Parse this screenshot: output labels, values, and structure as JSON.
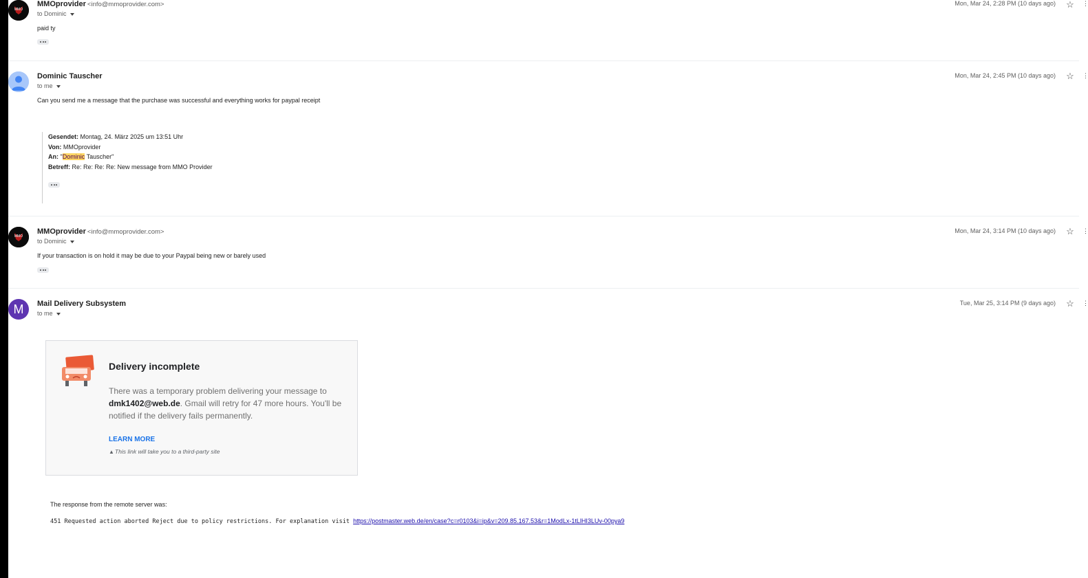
{
  "messages": [
    {
      "sender": "MMOprovider",
      "address": "<info@mmoprovider.com>",
      "to": "to Dominic",
      "date": "Mon, Mar 24, 2:28 PM (10 days ago)",
      "body": "paid ty",
      "avatar_icon": "logo-avatar"
    },
    {
      "sender": "Dominic Tauscher",
      "to": "to me",
      "date": "Mon, Mar 24, 2:45 PM (10 days ago)",
      "body": "Can you send me a message that the purchase was successful and everything works for paypal receipt",
      "avatar_icon": "person-avatar",
      "quote": {
        "gesendet_label": "Gesendet:",
        "gesendet_value": "Montag, 24. März 2025 um 13:51 Uhr",
        "von_label": "Von:",
        "von_value": "MMOprovider",
        "an_label": "An:",
        "an_quote_open": "\"",
        "an_highlight": "Dominic",
        "an_rest": " Tauscher\"",
        "betreff_label": "Betreff:",
        "betreff_value": "Re: Re: Re: Re: New message from MMO Provider"
      }
    },
    {
      "sender": "MMOprovider",
      "address": "<info@mmoprovider.com>",
      "to": "to Dominic",
      "date": "Mon, Mar 24, 3:14 PM (10 days ago)",
      "body": "If your transaction is on hold it may be due to your Paypal being new or barely used",
      "avatar_icon": "logo-avatar"
    },
    {
      "sender": "Mail Delivery Subsystem",
      "to": "to me",
      "date": "Tue, Mar 25, 3:14 PM (9 days ago)",
      "avatar_letter": "M",
      "card": {
        "title": "Delivery incomplete",
        "text_before": "There was a temporary problem delivering your message to ",
        "email": "dmk1402@web.de",
        "text_after": ". Gmail will retry for 47 more hours. You'll be notified if the delivery fails permanently.",
        "learn_more": "LEARN MORE",
        "disclaimer": "This link will take you to a third-party site"
      },
      "response_label": "The response from the remote server was:",
      "response_code": "451 Requested action aborted Reject due to policy restrictions. For explanation visit ",
      "response_link": "https://postmaster.web.de/en/case?c=r0103&i=ip&v=209.85.167.53&r=1ModLx-1tLlHI3LUv-00pya9"
    }
  ],
  "colors": {
    "purple_quote": "#500050",
    "highlight": "#fdd663",
    "link_blue": "#1a73e8",
    "avatar_purple": "#5e35b1"
  }
}
